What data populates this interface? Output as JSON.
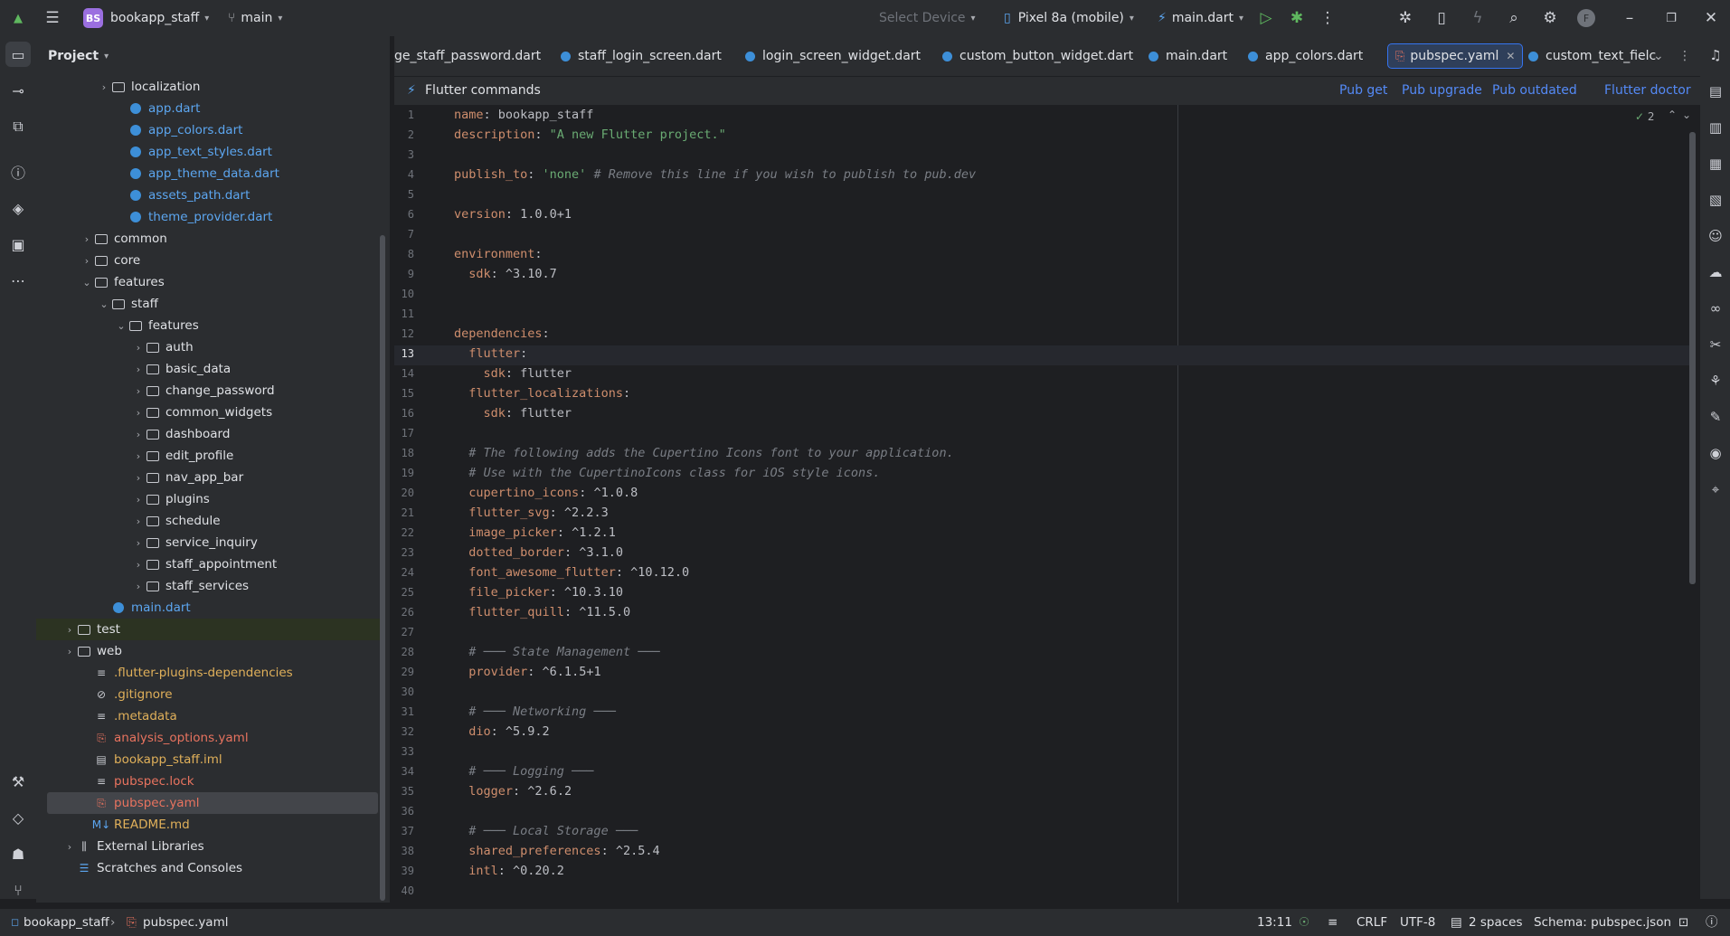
{
  "titlebar": {
    "project_badge": "BS",
    "project_name": "bookapp_staff",
    "branch": "main",
    "device_selector": "Select Device",
    "device": "Pixel 8a (mobile)",
    "run_config": "main.dart",
    "avatar_letter": "F"
  },
  "project_panel": {
    "title": "Project",
    "tree": [
      {
        "label": "localization",
        "type": "folder",
        "indent": 3,
        "expanded": false
      },
      {
        "label": "app.dart",
        "type": "dart",
        "indent": 4
      },
      {
        "label": "app_colors.dart",
        "type": "dart",
        "indent": 4
      },
      {
        "label": "app_text_styles.dart",
        "type": "dart",
        "indent": 4
      },
      {
        "label": "app_theme_data.dart",
        "type": "dart",
        "indent": 4
      },
      {
        "label": "assets_path.dart",
        "type": "dart",
        "indent": 4
      },
      {
        "label": "theme_provider.dart",
        "type": "dart",
        "indent": 4
      },
      {
        "label": "common",
        "type": "folder",
        "indent": 2,
        "expanded": false
      },
      {
        "label": "core",
        "type": "folder",
        "indent": 2,
        "expanded": false
      },
      {
        "label": "features",
        "type": "folder",
        "indent": 2,
        "expanded": true
      },
      {
        "label": "staff",
        "type": "folder",
        "indent": 3,
        "expanded": true
      },
      {
        "label": "features",
        "type": "folder",
        "indent": 4,
        "expanded": true
      },
      {
        "label": "auth",
        "type": "folder",
        "indent": 5,
        "expanded": false
      },
      {
        "label": "basic_data",
        "type": "folder",
        "indent": 5,
        "expanded": false
      },
      {
        "label": "change_password",
        "type": "folder",
        "indent": 5,
        "expanded": false
      },
      {
        "label": "common_widgets",
        "type": "folder",
        "indent": 5,
        "expanded": false
      },
      {
        "label": "dashboard",
        "type": "folder",
        "indent": 5,
        "expanded": false
      },
      {
        "label": "edit_profile",
        "type": "folder",
        "indent": 5,
        "expanded": false
      },
      {
        "label": "nav_app_bar",
        "type": "folder",
        "indent": 5,
        "expanded": false
      },
      {
        "label": "plugins",
        "type": "folder",
        "indent": 5,
        "expanded": false
      },
      {
        "label": "schedule",
        "type": "folder",
        "indent": 5,
        "expanded": false
      },
      {
        "label": "service_inquiry",
        "type": "folder",
        "indent": 5,
        "expanded": false
      },
      {
        "label": "staff_appointment",
        "type": "folder",
        "indent": 5,
        "expanded": false
      },
      {
        "label": "staff_services",
        "type": "folder",
        "indent": 5,
        "expanded": false
      },
      {
        "label": "main.dart",
        "type": "dart",
        "indent": 3
      },
      {
        "label": "test",
        "type": "folder",
        "indent": 1,
        "expanded": false,
        "highlight": true
      },
      {
        "label": "web",
        "type": "folder",
        "indent": 1,
        "expanded": false
      },
      {
        "label": ".flutter-plugins-dependencies",
        "type": "textfile-yellow",
        "indent": 2
      },
      {
        "label": ".gitignore",
        "type": "ignore",
        "indent": 2
      },
      {
        "label": ".metadata",
        "type": "textfile",
        "indent": 2
      },
      {
        "label": "analysis_options.yaml",
        "type": "yaml",
        "indent": 2
      },
      {
        "label": "bookapp_staff.iml",
        "type": "iml",
        "indent": 2
      },
      {
        "label": "pubspec.lock",
        "type": "textfile-red",
        "indent": 2
      },
      {
        "label": "pubspec.yaml",
        "type": "yaml",
        "indent": 2,
        "selected": true
      },
      {
        "label": "README.md",
        "type": "md",
        "indent": 2
      },
      {
        "label": "External Libraries",
        "type": "library",
        "indent": 1,
        "expanded": false
      },
      {
        "label": "Scratches and Consoles",
        "type": "scratch",
        "indent": 1
      }
    ]
  },
  "tabs": [
    {
      "label": "ge_staff_password.dart",
      "type": "dart"
    },
    {
      "label": "staff_login_screen.dart",
      "type": "dart"
    },
    {
      "label": "login_screen_widget.dart",
      "type": "dart"
    },
    {
      "label": "custom_button_widget.dart",
      "type": "dart"
    },
    {
      "label": "main.dart",
      "type": "dart"
    },
    {
      "label": "app_colors.dart",
      "type": "dart"
    },
    {
      "label": "pubspec.yaml",
      "type": "yaml",
      "active": true
    },
    {
      "label": "custom_text_fielc",
      "type": "dart"
    }
  ],
  "flutter_bar": {
    "title": "Flutter commands",
    "pub_get": "Pub get",
    "pub_upgrade": "Pub upgrade",
    "pub_outdated": "Pub outdated",
    "flutter_doctor": "Flutter doctor",
    "inspection_count": "2"
  },
  "editor": {
    "current_line": 13,
    "lines": [
      "name: bookapp_staff",
      "description: \"A new Flutter project.\"",
      "",
      "publish_to: 'none' # Remove this line if you wish to publish to pub.dev",
      "",
      "version: 1.0.0+1",
      "",
      "environment:",
      "  sdk: ^3.10.7",
      "",
      "",
      "dependencies:",
      "  flutter:",
      "    sdk: flutter",
      "  flutter_localizations:",
      "    sdk: flutter",
      "",
      "  # The following adds the Cupertino Icons font to your application.",
      "  # Use with the CupertinoIcons class for iOS style icons.",
      "  cupertino_icons: ^1.0.8",
      "  flutter_svg: ^2.2.3",
      "  image_picker: ^1.2.1",
      "  dotted_border: ^3.1.0",
      "  font_awesome_flutter: ^10.12.0",
      "  file_picker: ^10.3.10",
      "  flutter_quill: ^11.5.0",
      "",
      "  # ─── State Management ───",
      "  provider: ^6.1.5+1",
      "",
      "  # ─── Networking ───",
      "  dio: ^5.9.2",
      "",
      "  # ─── Logging ───",
      "  logger: ^2.6.2",
      "",
      "  # ─── Local Storage ───",
      "  shared_preferences: ^2.5.4",
      "  intl: ^0.20.2",
      ""
    ]
  },
  "statusbar": {
    "project": "bookapp_staff",
    "file": "pubspec.yaml",
    "position": "13:11",
    "line_ending": "CRLF",
    "encoding": "UTF-8",
    "indent": "2 spaces",
    "schema": "Schema: pubspec.json"
  }
}
